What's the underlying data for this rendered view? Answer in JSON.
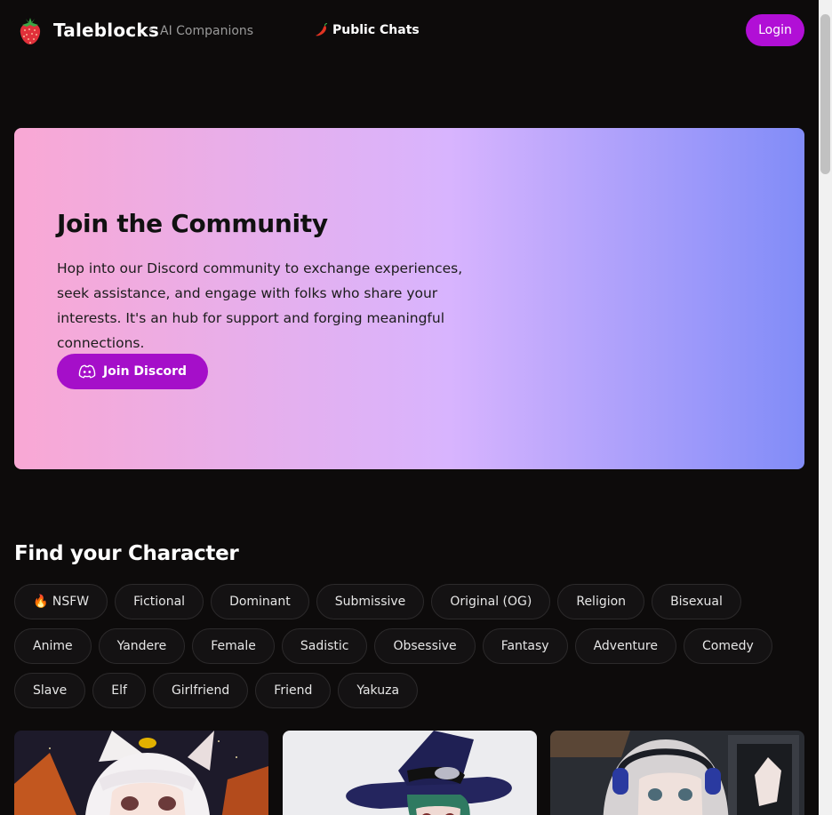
{
  "header": {
    "brand": "Taleblocks",
    "separator": "•",
    "subtitle": "AI Companions",
    "nav_public_chats": "Public Chats",
    "login_label": "Login"
  },
  "banner": {
    "title": "Join the Community",
    "text": "Hop into our Discord community to exchange experiences, seek assistance, and engage with folks who share your interests. It's an hub for support and forging meaningful connections.",
    "button_label": "Join Discord"
  },
  "characters": {
    "title": "Find your Character",
    "tags": [
      "🔥 NSFW",
      "Fictional",
      "Dominant",
      "Submissive",
      "Original (OG)",
      "Religion",
      "Bisexual",
      "Anime",
      "Yandere",
      "Female",
      "Sadistic",
      "Obsessive",
      "Fantasy",
      "Adventure",
      "Comedy",
      "Slave",
      "Elf",
      "Girlfriend",
      "Friend",
      "Yakuza"
    ]
  },
  "colors": {
    "accent": "#b10fd6",
    "background": "#0d0b0b",
    "banner_gradient": [
      "#f9a8d4",
      "#d8b4fe",
      "#818cf8"
    ]
  }
}
